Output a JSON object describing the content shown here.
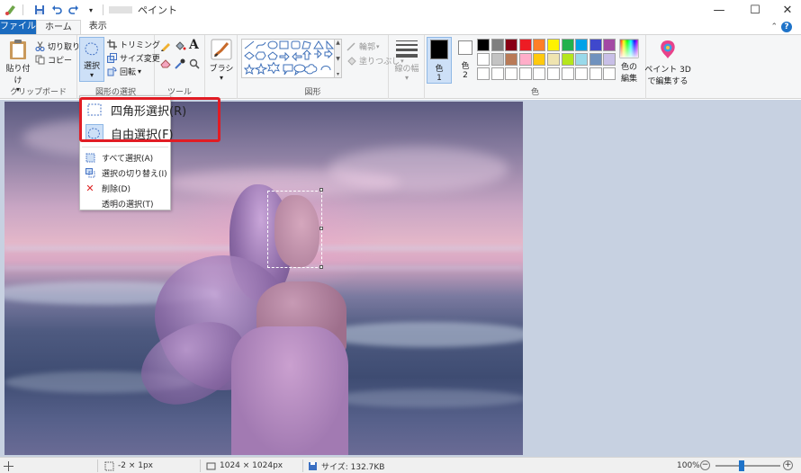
{
  "window": {
    "title": "ペイント",
    "minimize": "—",
    "maximize": "☐",
    "close": "✕"
  },
  "tabs": [
    "ファイル",
    "ホーム",
    "表示"
  ],
  "ribbon": {
    "clipboard": {
      "paste": "貼り付け",
      "cut": "切り取り",
      "copy": "コピー",
      "label": "クリップボード"
    },
    "image": {
      "select": "選択",
      "crop": "トリミング",
      "resize": "サイズ変更",
      "rotate": "回転",
      "label": "図形の選択"
    },
    "tools": {
      "label": "ツール"
    },
    "brushes": {
      "label": "ブラシ"
    },
    "shapes": {
      "outline": "輪郭",
      "fill": "塗りつぶし",
      "label": "図形"
    },
    "size": {
      "label": "線の幅"
    },
    "colors": {
      "color1": "色",
      "color1_num": "1",
      "color2": "色",
      "color2_num": "2",
      "edit_line1": "色の",
      "edit_line2": "編集",
      "label": "色",
      "palette": [
        "#000000",
        "#7f7f7f",
        "#880015",
        "#ed1c24",
        "#ff7f27",
        "#fff200",
        "#22b14c",
        "#00a2e8",
        "#3f48cc",
        "#a349a4",
        "#ffffff",
        "#c3c3c3",
        "#b97a57",
        "#ffaec9",
        "#ffc90e",
        "#efe4b0",
        "#b5e61d",
        "#99d9ea",
        "#7092be",
        "#c8bfe7"
      ]
    },
    "paint3d": {
      "line1": "ペイント 3D",
      "line2": "で編集する"
    }
  },
  "select_menu": {
    "rect": "四角形選択(R)",
    "free": "自由選択(F)",
    "select_all": "すべて選択(A)",
    "invert": "選択の切り替え(I)",
    "delete": "削除(D)",
    "transparent": "透明の選択(T)"
  },
  "status": {
    "position": "-2 × 1px",
    "dimensions": "1024 × 1024px",
    "size": "サイズ: 132.7KB",
    "zoom": "100%",
    "zoom_out": "−",
    "zoom_in": "+"
  },
  "colors": {
    "accent": "#1b6bbf",
    "highlight": "#e11c24"
  }
}
